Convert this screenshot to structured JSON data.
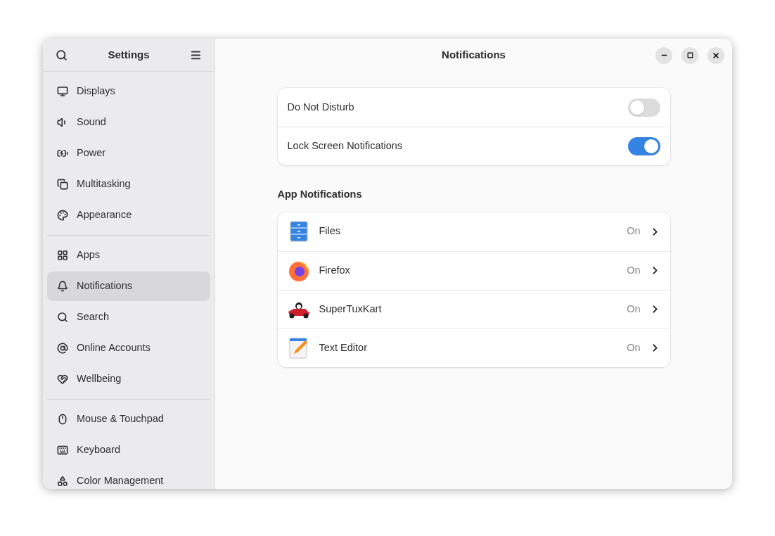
{
  "sidebar": {
    "title": "Settings",
    "groups": [
      {
        "items": [
          {
            "label": "Displays",
            "selected": false
          },
          {
            "label": "Sound",
            "selected": false
          },
          {
            "label": "Power",
            "selected": false
          },
          {
            "label": "Multitasking",
            "selected": false
          },
          {
            "label": "Appearance",
            "selected": false
          }
        ]
      },
      {
        "items": [
          {
            "label": "Apps",
            "selected": false
          },
          {
            "label": "Notifications",
            "selected": true
          },
          {
            "label": "Search",
            "selected": false
          },
          {
            "label": "Online Accounts",
            "selected": false
          },
          {
            "label": "Wellbeing",
            "selected": false
          }
        ]
      },
      {
        "items": [
          {
            "label": "Mouse & Touchpad",
            "selected": false
          },
          {
            "label": "Keyboard",
            "selected": false
          },
          {
            "label": "Color Management",
            "selected": false
          }
        ]
      }
    ]
  },
  "window": {
    "title": "Notifications"
  },
  "toggles": [
    {
      "label": "Do Not Disturb",
      "on": false
    },
    {
      "label": "Lock Screen Notifications",
      "on": true
    }
  ],
  "app_notifications": {
    "heading": "App Notifications",
    "apps": [
      {
        "name": "Files",
        "status": "On"
      },
      {
        "name": "Firefox",
        "status": "On"
      },
      {
        "name": "SuperTuxKart",
        "status": "On"
      },
      {
        "name": "Text Editor",
        "status": "On"
      }
    ]
  }
}
